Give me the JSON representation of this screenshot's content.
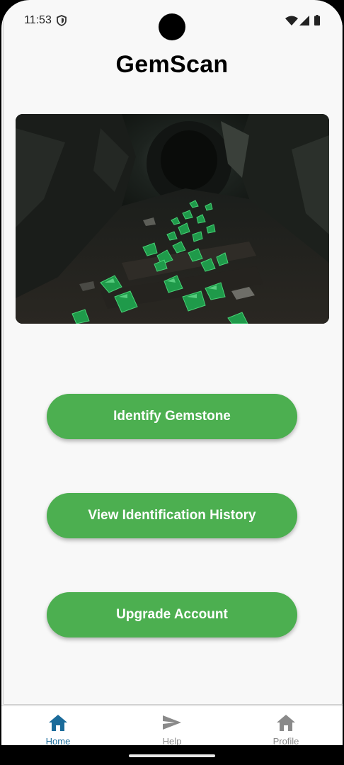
{
  "status_bar": {
    "time": "11:53"
  },
  "app": {
    "title": "GemScan"
  },
  "hero": {
    "description": "dark mine tunnel with green gemstones"
  },
  "buttons": {
    "identify": "Identify Gemstone",
    "history": "View Identification History",
    "upgrade": "Upgrade Account"
  },
  "nav": {
    "items": [
      {
        "label": "Home",
        "icon": "home-icon",
        "active": true
      },
      {
        "label": "Help",
        "icon": "send-icon",
        "active": false
      },
      {
        "label": "Profile",
        "icon": "home-icon",
        "active": false
      }
    ]
  },
  "colors": {
    "accent_green": "#4caf50",
    "nav_active": "#1a6b9a",
    "nav_inactive": "#8a8a8a",
    "background": "#f8f8f8"
  }
}
